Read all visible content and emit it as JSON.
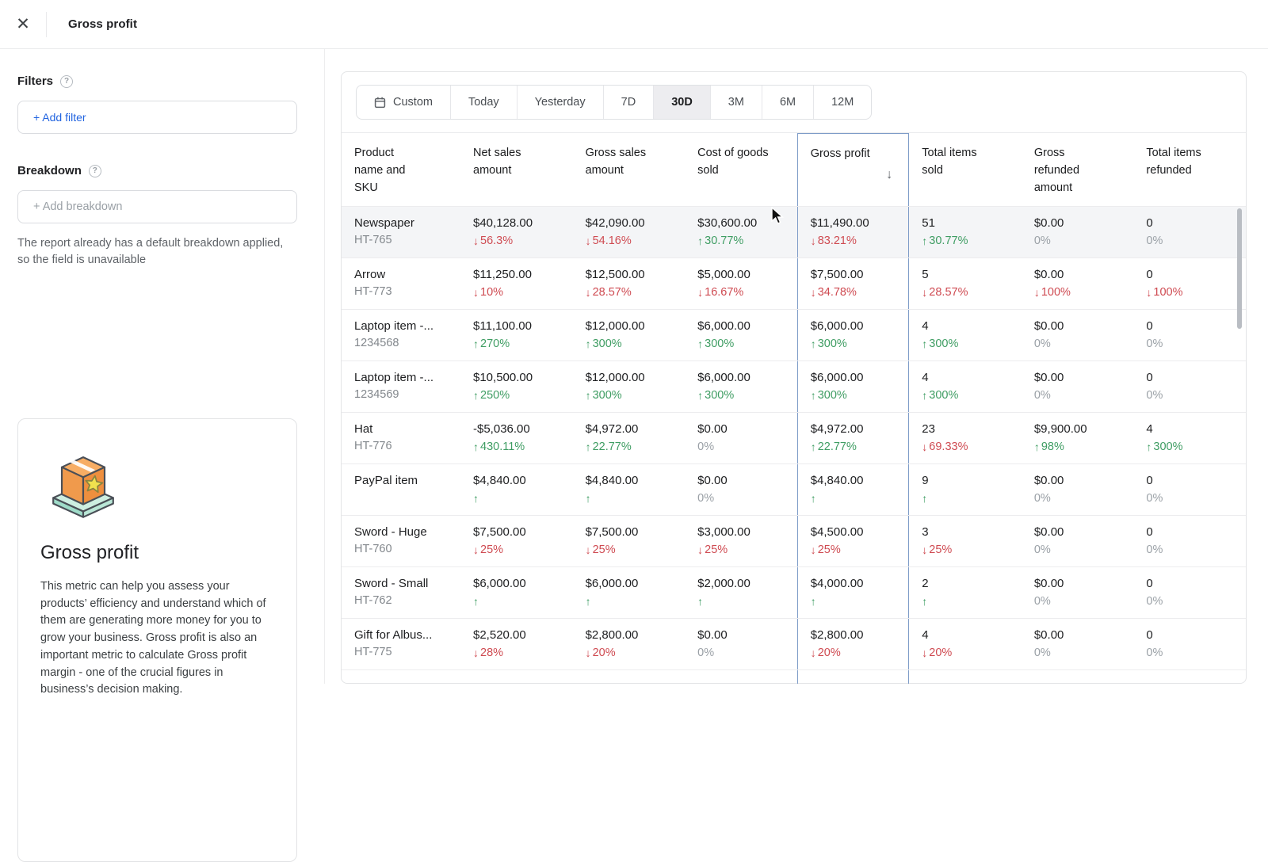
{
  "topbar": {
    "title": "Gross profit"
  },
  "sidebar": {
    "filters": {
      "label": "Filters",
      "add_button": "+ Add filter"
    },
    "breakdown": {
      "label": "Breakdown",
      "placeholder": "+ Add breakdown",
      "note": "The report already has a default breakdown applied, so the field is unavailable"
    },
    "metric_card": {
      "title": "Gross profit",
      "description": "This metric can help you assess your products’ efficiency and understand which of them are generating more money for you to grow your business. Gross profit is also an important metric to calculate Gross profit margin - one of the crucial figures in business’s decision making."
    }
  },
  "daterange": {
    "selected": "30D",
    "options": [
      {
        "label": "Custom",
        "icon": "calendar-icon"
      },
      {
        "label": "Today"
      },
      {
        "label": "Yesterday"
      },
      {
        "label": "7D"
      },
      {
        "label": "30D"
      },
      {
        "label": "3M"
      },
      {
        "label": "6M"
      },
      {
        "label": "12M"
      }
    ]
  },
  "colors": {
    "positive": "#3f9d63",
    "negative": "#cf4b52",
    "neutral": "#9aa0a6",
    "accent_link": "#2264e0",
    "sorted_column_outline": "#7e9cc8"
  },
  "table": {
    "columns": [
      {
        "key": "product",
        "label": "Product name and SKU"
      },
      {
        "key": "net_sales_amount",
        "label": "Net sales amount"
      },
      {
        "key": "gross_sales_amount",
        "label": "Gross sales amount"
      },
      {
        "key": "cost_of_goods_sold",
        "label": "Cost of goods sold"
      },
      {
        "key": "gross_profit",
        "label": "Gross profit",
        "highlighted": true,
        "sorted": "desc"
      },
      {
        "key": "total_items_sold",
        "label": "Total items sold"
      },
      {
        "key": "gross_refunded_amount",
        "label": "Gross refunded amount"
      },
      {
        "key": "total_items_refunded",
        "label": "Total items refunded"
      }
    ],
    "rows": [
      {
        "product": "Newspaper",
        "sku": "HT-765",
        "highlighted": true,
        "metrics": [
          {
            "value": "$40,128.00",
            "dir": "down",
            "change": "56.3%",
            "tone": "neg"
          },
          {
            "value": "$42,090.00",
            "dir": "down",
            "change": "54.16%",
            "tone": "neg"
          },
          {
            "value": "$30,600.00",
            "dir": "up",
            "change": "30.77%",
            "tone": "pos"
          },
          {
            "value": "$11,490.00",
            "dir": "down",
            "change": "83.21%",
            "tone": "neg"
          },
          {
            "value": "51",
            "dir": "up",
            "change": "30.77%",
            "tone": "pos"
          },
          {
            "value": "$0.00",
            "dir": "none",
            "change": "0%",
            "tone": "neutral"
          },
          {
            "value": "0",
            "dir": "none",
            "change": "0%",
            "tone": "neutral"
          }
        ]
      },
      {
        "product": "Arrow",
        "sku": "HT-773",
        "metrics": [
          {
            "value": "$11,250.00",
            "dir": "down",
            "change": "10%",
            "tone": "neg"
          },
          {
            "value": "$12,500.00",
            "dir": "down",
            "change": "28.57%",
            "tone": "neg"
          },
          {
            "value": "$5,000.00",
            "dir": "down",
            "change": "16.67%",
            "tone": "neg"
          },
          {
            "value": "$7,500.00",
            "dir": "down",
            "change": "34.78%",
            "tone": "neg"
          },
          {
            "value": "5",
            "dir": "down",
            "change": "28.57%",
            "tone": "neg"
          },
          {
            "value": "$0.00",
            "dir": "down",
            "change": "100%",
            "tone": "neg"
          },
          {
            "value": "0",
            "dir": "down",
            "change": "100%",
            "tone": "neg"
          }
        ]
      },
      {
        "product": "Laptop item -...",
        "sku": "1234568",
        "metrics": [
          {
            "value": "$11,100.00",
            "dir": "up",
            "change": "270%",
            "tone": "pos"
          },
          {
            "value": "$12,000.00",
            "dir": "up",
            "change": "300%",
            "tone": "pos"
          },
          {
            "value": "$6,000.00",
            "dir": "up",
            "change": "300%",
            "tone": "pos"
          },
          {
            "value": "$6,000.00",
            "dir": "up",
            "change": "300%",
            "tone": "pos"
          },
          {
            "value": "4",
            "dir": "up",
            "change": "300%",
            "tone": "pos"
          },
          {
            "value": "$0.00",
            "dir": "none",
            "change": "0%",
            "tone": "neutral"
          },
          {
            "value": "0",
            "dir": "none",
            "change": "0%",
            "tone": "neutral"
          }
        ]
      },
      {
        "product": "Laptop item -...",
        "sku": "1234569",
        "metrics": [
          {
            "value": "$10,500.00",
            "dir": "up",
            "change": "250%",
            "tone": "pos"
          },
          {
            "value": "$12,000.00",
            "dir": "up",
            "change": "300%",
            "tone": "pos"
          },
          {
            "value": "$6,000.00",
            "dir": "up",
            "change": "300%",
            "tone": "pos"
          },
          {
            "value": "$6,000.00",
            "dir": "up",
            "change": "300%",
            "tone": "pos"
          },
          {
            "value": "4",
            "dir": "up",
            "change": "300%",
            "tone": "pos"
          },
          {
            "value": "$0.00",
            "dir": "none",
            "change": "0%",
            "tone": "neutral"
          },
          {
            "value": "0",
            "dir": "none",
            "change": "0%",
            "tone": "neutral"
          }
        ]
      },
      {
        "product": "Hat",
        "sku": "HT-776",
        "metrics": [
          {
            "value": "-$5,036.00",
            "dir": "up",
            "change": "430.11%",
            "tone": "pos"
          },
          {
            "value": "$4,972.00",
            "dir": "up",
            "change": "22.77%",
            "tone": "pos"
          },
          {
            "value": "$0.00",
            "dir": "none",
            "change": "0%",
            "tone": "neutral"
          },
          {
            "value": "$4,972.00",
            "dir": "up",
            "change": "22.77%",
            "tone": "pos"
          },
          {
            "value": "23",
            "dir": "down",
            "change": "69.33%",
            "tone": "neg"
          },
          {
            "value": "$9,900.00",
            "dir": "up",
            "change": "98%",
            "tone": "pos"
          },
          {
            "value": "4",
            "dir": "up",
            "change": "300%",
            "tone": "pos"
          }
        ]
      },
      {
        "product": "PayPal item",
        "sku": "",
        "metrics": [
          {
            "value": "$4,840.00",
            "dir": "up",
            "change": "",
            "tone": "pos"
          },
          {
            "value": "$4,840.00",
            "dir": "up",
            "change": "",
            "tone": "pos"
          },
          {
            "value": "$0.00",
            "dir": "none",
            "change": "0%",
            "tone": "neutral"
          },
          {
            "value": "$4,840.00",
            "dir": "up",
            "change": "",
            "tone": "pos"
          },
          {
            "value": "9",
            "dir": "up",
            "change": "",
            "tone": "pos"
          },
          {
            "value": "$0.00",
            "dir": "none",
            "change": "0%",
            "tone": "neutral"
          },
          {
            "value": "0",
            "dir": "none",
            "change": "0%",
            "tone": "neutral"
          }
        ]
      },
      {
        "product": "Sword - Huge",
        "sku": "HT-760",
        "metrics": [
          {
            "value": "$7,500.00",
            "dir": "down",
            "change": "25%",
            "tone": "neg"
          },
          {
            "value": "$7,500.00",
            "dir": "down",
            "change": "25%",
            "tone": "neg"
          },
          {
            "value": "$3,000.00",
            "dir": "down",
            "change": "25%",
            "tone": "neg"
          },
          {
            "value": "$4,500.00",
            "dir": "down",
            "change": "25%",
            "tone": "neg"
          },
          {
            "value": "3",
            "dir": "down",
            "change": "25%",
            "tone": "neg"
          },
          {
            "value": "$0.00",
            "dir": "none",
            "change": "0%",
            "tone": "neutral"
          },
          {
            "value": "0",
            "dir": "none",
            "change": "0%",
            "tone": "neutral"
          }
        ]
      },
      {
        "product": "Sword - Small",
        "sku": "HT-762",
        "metrics": [
          {
            "value": "$6,000.00",
            "dir": "up",
            "change": "",
            "tone": "pos"
          },
          {
            "value": "$6,000.00",
            "dir": "up",
            "change": "",
            "tone": "pos"
          },
          {
            "value": "$2,000.00",
            "dir": "up",
            "change": "",
            "tone": "pos"
          },
          {
            "value": "$4,000.00",
            "dir": "up",
            "change": "",
            "tone": "pos"
          },
          {
            "value": "2",
            "dir": "up",
            "change": "",
            "tone": "pos"
          },
          {
            "value": "$0.00",
            "dir": "none",
            "change": "0%",
            "tone": "neutral"
          },
          {
            "value": "0",
            "dir": "none",
            "change": "0%",
            "tone": "neutral"
          }
        ]
      },
      {
        "product": "Gift for Albus...",
        "sku": "HT-775",
        "metrics": [
          {
            "value": "$2,520.00",
            "dir": "down",
            "change": "28%",
            "tone": "neg"
          },
          {
            "value": "$2,800.00",
            "dir": "down",
            "change": "20%",
            "tone": "neg"
          },
          {
            "value": "$0.00",
            "dir": "none",
            "change": "0%",
            "tone": "neutral"
          },
          {
            "value": "$2,800.00",
            "dir": "down",
            "change": "20%",
            "tone": "neg"
          },
          {
            "value": "4",
            "dir": "down",
            "change": "20%",
            "tone": "neg"
          },
          {
            "value": "$0.00",
            "dir": "none",
            "change": "0%",
            "tone": "neutral"
          },
          {
            "value": "0",
            "dir": "none",
            "change": "0%",
            "tone": "neutral"
          }
        ]
      }
    ]
  }
}
